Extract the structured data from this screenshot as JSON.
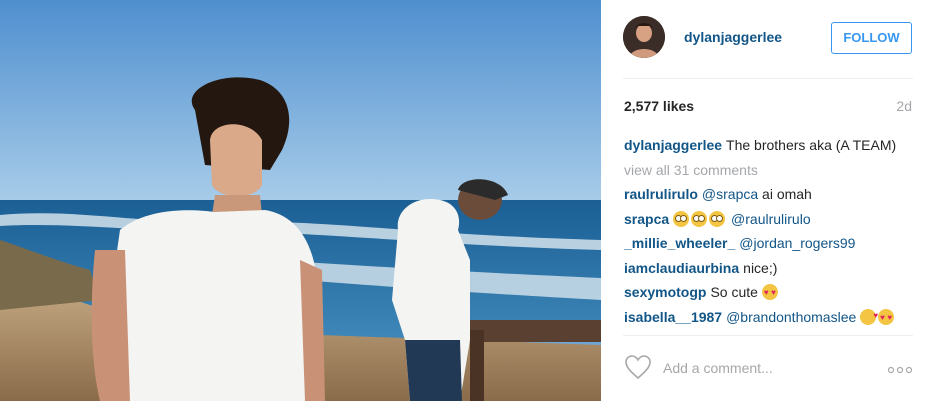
{
  "post": {
    "username": "dylanjaggerlee",
    "follow_label": "FOLLOW",
    "likes": "2,577 likes",
    "time_ago": "2d",
    "caption": {
      "user": "dylanjaggerlee",
      "text": "The brothers aka (A TEAM)"
    },
    "view_all": "view all 31 comments",
    "comments": [
      {
        "user": "raulrulirulo",
        "mention": "@srapca",
        "text": " ai omah"
      },
      {
        "user": "srapca",
        "emojis": [
          "flushed-emoji",
          "flushed-emoji",
          "flushed-emoji"
        ],
        "mention": "@raulrulirulo"
      },
      {
        "user": "_millie_wheeler_",
        "mention": "@jordan_rogers99"
      },
      {
        "user": "iamclaudiaurbina",
        "text": "nice;)"
      },
      {
        "user": "sexymotogp",
        "text": "So cute",
        "emojis": [
          "heart-eyes-emoji"
        ]
      },
      {
        "user": "isabella__1987",
        "mention": "@brandonthomaslee",
        "emojis": [
          "kiss-emoji",
          "heart-eyes-emoji"
        ]
      }
    ],
    "add_comment_placeholder": "Add a comment...",
    "icons": {
      "like": "heart-outline-icon",
      "more": "more-options-icon"
    },
    "colors": {
      "username": "#125688",
      "follow": "#3897f0",
      "muted": "#a5a7aa",
      "text": "#262626"
    }
  }
}
